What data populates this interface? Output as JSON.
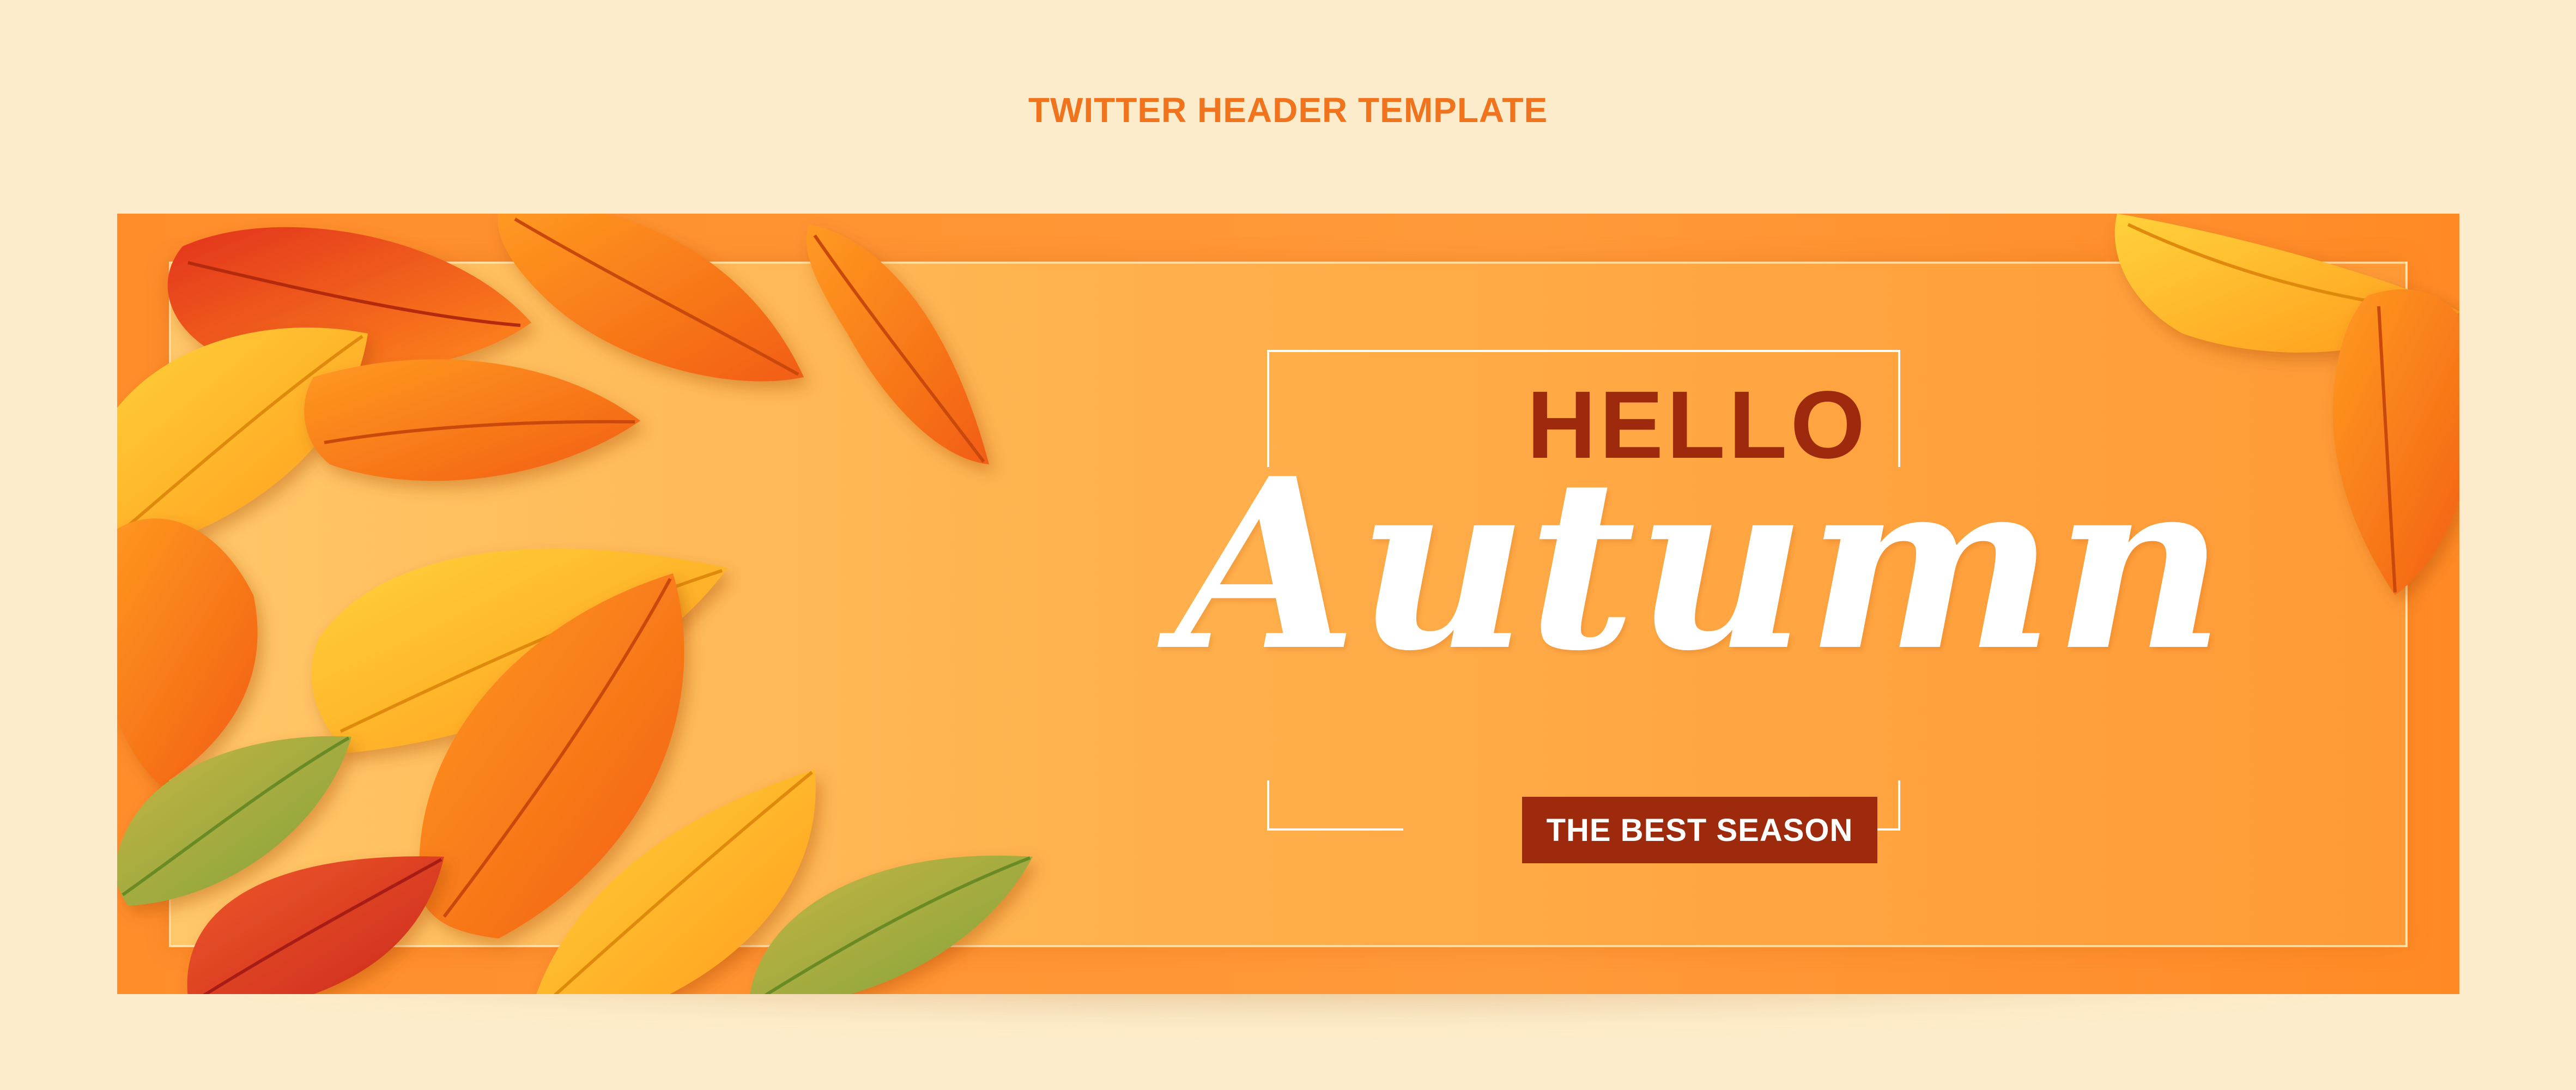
{
  "header": {
    "title": "TWITTER HEADER TEMPLATE"
  },
  "banner": {
    "greeting": "HELLO",
    "headline": "Autumn",
    "tagline": "THE BEST SEASON"
  },
  "colors": {
    "page_background": "#fdeccb",
    "heading_text": "#f0731e",
    "greeting_text": "#9e2a0d",
    "tagline_background": "#9e2a0d",
    "banner_orange": "#ff8d2a",
    "panel_light": "#ffc768"
  }
}
